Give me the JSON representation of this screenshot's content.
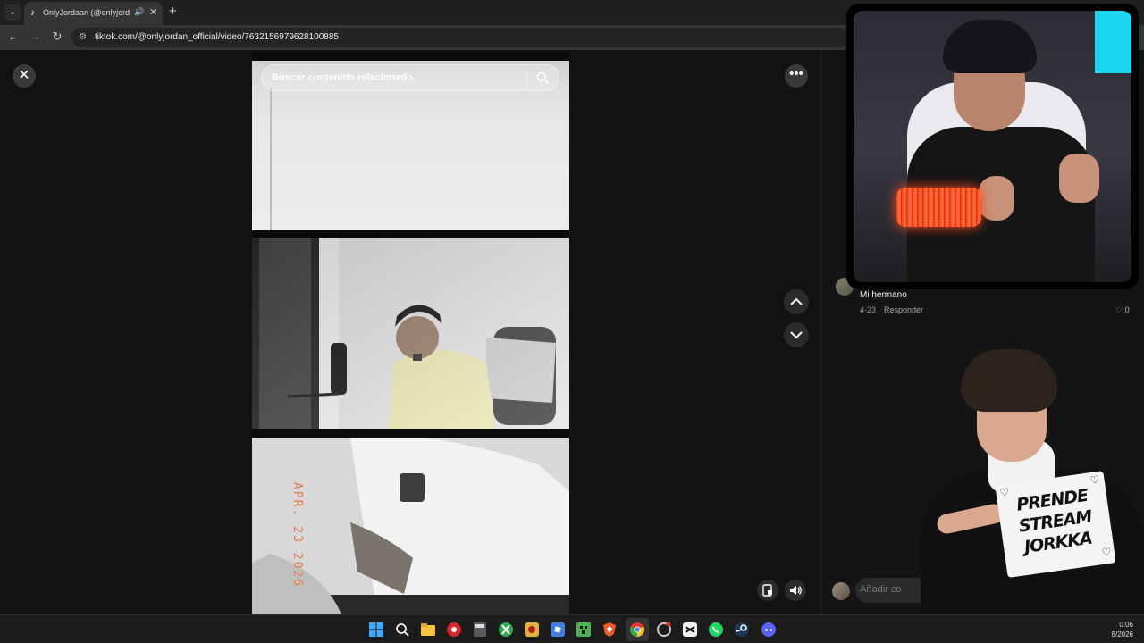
{
  "browser": {
    "tab": {
      "title": "OnlyJordaan (@onlyjordan_official) | TikTok",
      "favicon": "tiktok-icon",
      "audio_icon": "speaker-icon",
      "close_label": "✕"
    },
    "new_tab_label": "+",
    "url": "tiktok.com/@onlyjordan_official/video/7632156979628100885",
    "nav": {
      "back": "←",
      "forward": "→",
      "reload": "↻"
    }
  },
  "video_page": {
    "close_label": "✕",
    "more_label": "•••",
    "search": {
      "placeholder": "Buscar contenido relacionado"
    },
    "date_stamp": "APR. 23 2026",
    "controls": {
      "prev_icon": "chevron-up-icon",
      "next_icon": "chevron-down-icon",
      "volume_icon": "speaker-icon",
      "pip_icon": "floating-player-icon"
    }
  },
  "comments": {
    "items": [
      {
        "author": "Mi hermano",
        "date": "4-23",
        "reply_label": "Responder",
        "likes": "0"
      }
    ],
    "input_placeholder": "Añadir co"
  },
  "overlay": {
    "sign_lines": [
      "PRENDE",
      "STREAM",
      "JORKKA"
    ]
  },
  "taskbar": {
    "icons": [
      "windows-icon",
      "search-icon",
      "file-explorer-icon",
      "app-red-icon",
      "calculator-icon",
      "xbox-icon",
      "game-icon",
      "roblox-icon",
      "minecraft-icon",
      "brave-icon",
      "chrome-icon",
      "opera-gx-icon",
      "capcut-icon",
      "whatsapp-icon",
      "steam-icon",
      "discord-icon"
    ],
    "time": "0:06",
    "date": "8/2026"
  }
}
